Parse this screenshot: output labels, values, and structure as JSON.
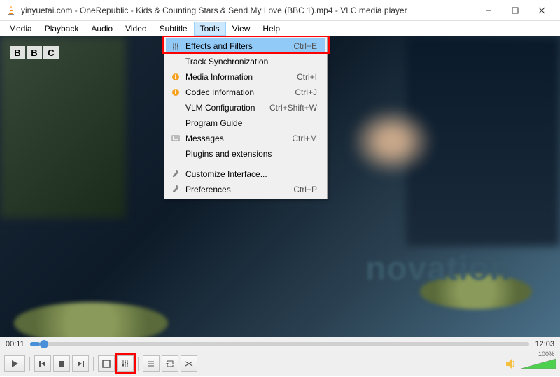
{
  "title": "yinyuetai.com - OneRepublic - Kids & Counting Stars & Send My Love (BBC 1).mp4 - VLC media player",
  "menubar": [
    "Media",
    "Playback",
    "Audio",
    "Video",
    "Subtitle",
    "Tools",
    "View",
    "Help"
  ],
  "active_menu": "Tools",
  "dropdown": [
    {
      "icon": "sliders",
      "label": "Effects and Filters",
      "shortcut": "Ctrl+E",
      "hl": true
    },
    {
      "icon": "",
      "label": "Track Synchronization",
      "shortcut": ""
    },
    {
      "icon": "info",
      "label": "Media Information",
      "shortcut": "Ctrl+I"
    },
    {
      "icon": "info",
      "label": "Codec Information",
      "shortcut": "Ctrl+J"
    },
    {
      "icon": "",
      "label": "VLM Configuration",
      "shortcut": "Ctrl+Shift+W"
    },
    {
      "icon": "",
      "label": "Program Guide",
      "shortcut": ""
    },
    {
      "icon": "msg",
      "label": "Messages",
      "shortcut": "Ctrl+M"
    },
    {
      "icon": "",
      "label": "Plugins and extensions",
      "shortcut": ""
    },
    {
      "sep": true
    },
    {
      "icon": "wrench",
      "label": "Customize Interface...",
      "shortcut": ""
    },
    {
      "icon": "wrench",
      "label": "Preferences",
      "shortcut": "Ctrl+P"
    }
  ],
  "bbc": [
    "B",
    "B",
    "C"
  ],
  "novation_text": "novation",
  "time_current": "00:11",
  "time_total": "12:03",
  "volume_pct": "100%",
  "highlight_color": "#ff0000"
}
